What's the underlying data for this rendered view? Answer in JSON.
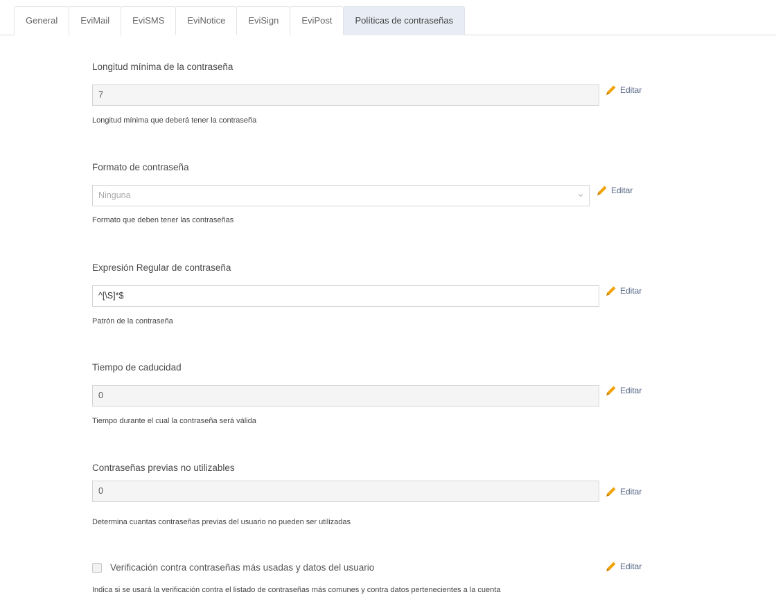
{
  "tabs": [
    {
      "label": "General",
      "active": false
    },
    {
      "label": "EviMail",
      "active": false
    },
    {
      "label": "EviSMS",
      "active": false
    },
    {
      "label": "EviNotice",
      "active": false
    },
    {
      "label": "EviSign",
      "active": false
    },
    {
      "label": "EviPost",
      "active": false
    },
    {
      "label": "Políticas de contraseñas",
      "active": true
    }
  ],
  "edit_label": "Editar",
  "accent_color": "#f0a30a",
  "settings": {
    "min_length": {
      "label": "Longitud mínima de la contraseña",
      "value": "7",
      "help": "Longitud mínima que deberá tener la contraseña"
    },
    "format": {
      "label": "Formato de contraseña",
      "selected": "Ninguna",
      "help": "Formato que deben tener las contraseñas"
    },
    "regex": {
      "label": "Expresión Regular de contraseña",
      "value": "^[\\S]*$",
      "help": "Patrón de la contraseña"
    },
    "expiration": {
      "label": "Tiempo de caducidad",
      "value": "0",
      "help": "Tiempo durante el cual la contraseña será válida"
    },
    "previous": {
      "label": "Contraseñas previas no utilizables",
      "value": "0",
      "help": "Determina cuantas contraseñas previas del usuario no pueden ser utilizadas"
    },
    "verification": {
      "label": "Verificación contra contraseñas más usadas y datos del usuario",
      "checked": false,
      "help": "Indica si se usará la verificación contra el listado de contraseñas más comunes y contra datos pertenecientes a la cuenta"
    }
  }
}
